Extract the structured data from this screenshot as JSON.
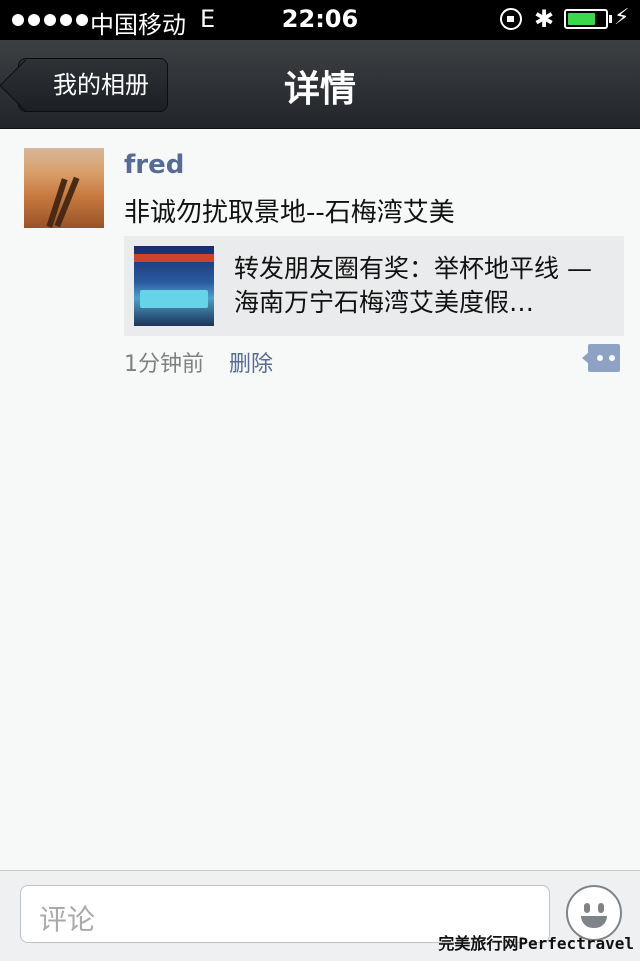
{
  "status_bar": {
    "carrier": "中国移动",
    "network": "E",
    "time": "22:06",
    "battery_level": 0.75,
    "battery_color": "#3bd84b"
  },
  "nav": {
    "back_label": "我的相册",
    "title": "详情"
  },
  "post": {
    "username": "fred",
    "text": "非诚勿扰取景地--石梅湾艾美",
    "share_card": {
      "text": "转发朋友圈有奖：举杯地平线 — 海南万宁石梅湾艾美度假…"
    },
    "time": "1分钟前",
    "delete_label": "删除",
    "link_color": "#576b95"
  },
  "comment_bar": {
    "placeholder": "评论",
    "emoji_icon": "smiley-face-icon"
  },
  "watermark": "完美旅行网Perfectravel"
}
